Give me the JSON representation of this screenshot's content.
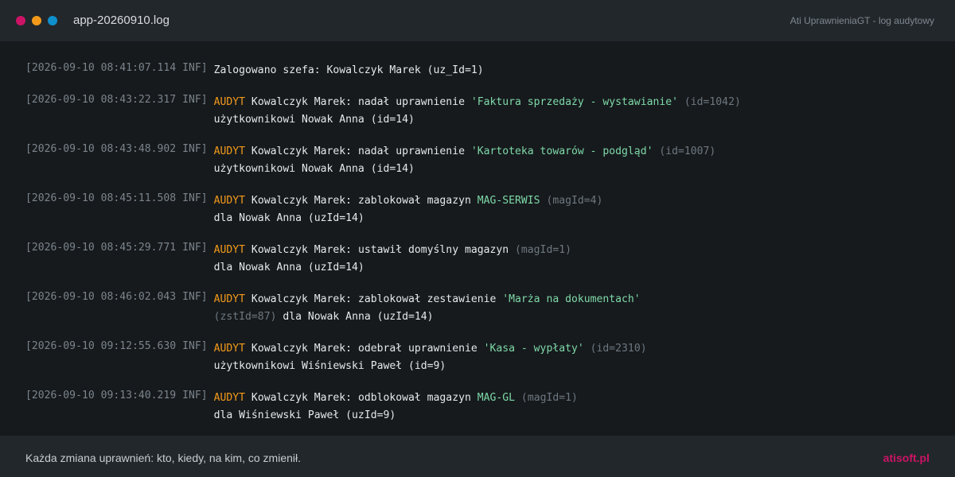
{
  "window": {
    "filename": "app-20260910.log",
    "app_title": "Ati UprawnieniaGT - log audytowy",
    "controls": [
      "close-dot",
      "minimize-dot",
      "maximize-dot"
    ]
  },
  "log": [
    {
      "prefix": "[2026-09-10 08:41:07.114 INF]",
      "line1": [
        {
          "t": "Zalogowano szefa: Kowalczyk Marek (uz_Id=1)",
          "c": "msg"
        }
      ],
      "line2": []
    },
    {
      "prefix": "[2026-09-10 08:43:22.317 INF]",
      "line1": [
        {
          "t": "AUDYT",
          "c": "audyt"
        },
        {
          "t": " Kowalczyk Marek: nadał uprawnienie ",
          "c": "msg"
        },
        {
          "t": "'Faktura sprzedaży - wystawianie'",
          "c": "quoted"
        },
        {
          "t": " (id=1042)",
          "c": "meta"
        }
      ],
      "line2": [
        {
          "t": "użytkownikowi Nowak Anna (id=14)",
          "c": "msg"
        }
      ]
    },
    {
      "prefix": "[2026-09-10 08:43:48.902 INF]",
      "line1": [
        {
          "t": "AUDYT",
          "c": "audyt"
        },
        {
          "t": " Kowalczyk Marek: nadał uprawnienie ",
          "c": "msg"
        },
        {
          "t": "'Kartoteka towarów - podgląd'",
          "c": "quoted"
        },
        {
          "t": " (id=1007)",
          "c": "meta"
        }
      ],
      "line2": [
        {
          "t": "użytkownikowi Nowak Anna (id=14)",
          "c": "msg"
        }
      ]
    },
    {
      "prefix": "[2026-09-10 08:45:11.508 INF]",
      "line1": [
        {
          "t": "AUDYT",
          "c": "audyt"
        },
        {
          "t": " Kowalczyk Marek: zablokował magazyn ",
          "c": "msg"
        },
        {
          "t": "MAG-SERWIS",
          "c": "code"
        },
        {
          "t": " (magId=4)",
          "c": "meta"
        }
      ],
      "line2": [
        {
          "t": "dla Nowak Anna (uzId=14)",
          "c": "msg"
        }
      ]
    },
    {
      "prefix": "[2026-09-10 08:45:29.771 INF]",
      "line1": [
        {
          "t": "AUDYT",
          "c": "audyt"
        },
        {
          "t": " Kowalczyk Marek: ustawił domyślny magazyn",
          "c": "msg"
        },
        {
          "t": " (magId=1)",
          "c": "meta"
        }
      ],
      "line2": [
        {
          "t": "dla Nowak Anna (uzId=14)",
          "c": "msg"
        }
      ]
    },
    {
      "prefix": "[2026-09-10 08:46:02.043 INF]",
      "line1": [
        {
          "t": "AUDYT",
          "c": "audyt"
        },
        {
          "t": " Kowalczyk Marek: zablokował zestawienie ",
          "c": "msg"
        },
        {
          "t": "'Marża na dokumentach'",
          "c": "quoted"
        }
      ],
      "line2": [
        {
          "t": "(zstId=87)",
          "c": "meta"
        },
        {
          "t": " dla Nowak Anna (uzId=14)",
          "c": "msg"
        }
      ]
    },
    {
      "prefix": "[2026-09-10 09:12:55.630 INF]",
      "line1": [
        {
          "t": "AUDYT",
          "c": "audyt"
        },
        {
          "t": " Kowalczyk Marek: odebrał uprawnienie ",
          "c": "msg"
        },
        {
          "t": "'Kasa - wypłaty'",
          "c": "quoted"
        },
        {
          "t": " (id=2310)",
          "c": "meta"
        }
      ],
      "line2": [
        {
          "t": "użytkownikowi Wiśniewski Paweł (id=9)",
          "c": "msg"
        }
      ]
    },
    {
      "prefix": "[2026-09-10 09:13:40.219 INF]",
      "line1": [
        {
          "t": "AUDYT",
          "c": "audyt"
        },
        {
          "t": " Kowalczyk Marek: odblokował magazyn ",
          "c": "msg"
        },
        {
          "t": "MAG-GL",
          "c": "code"
        },
        {
          "t": " (magId=1)",
          "c": "meta"
        }
      ],
      "line2": [
        {
          "t": "dla Wiśniewski Paweł (uzId=9)",
          "c": "msg"
        }
      ]
    }
  ],
  "footer": {
    "tagline": "Każda zmiana uprawnień: kto, kiedy, na kim, co zmienił.",
    "brand": "atisoft.pl"
  },
  "colors": {
    "background": "#161a1d",
    "bar": "#22272b",
    "audyt": "#f39a1a",
    "quoted": "#7fd9a8",
    "meta": "#6e7880",
    "brand": "#cc1466",
    "dot_red": "#cc1466",
    "dot_orange": "#f39a1a",
    "dot_blue": "#0f8fcc"
  }
}
